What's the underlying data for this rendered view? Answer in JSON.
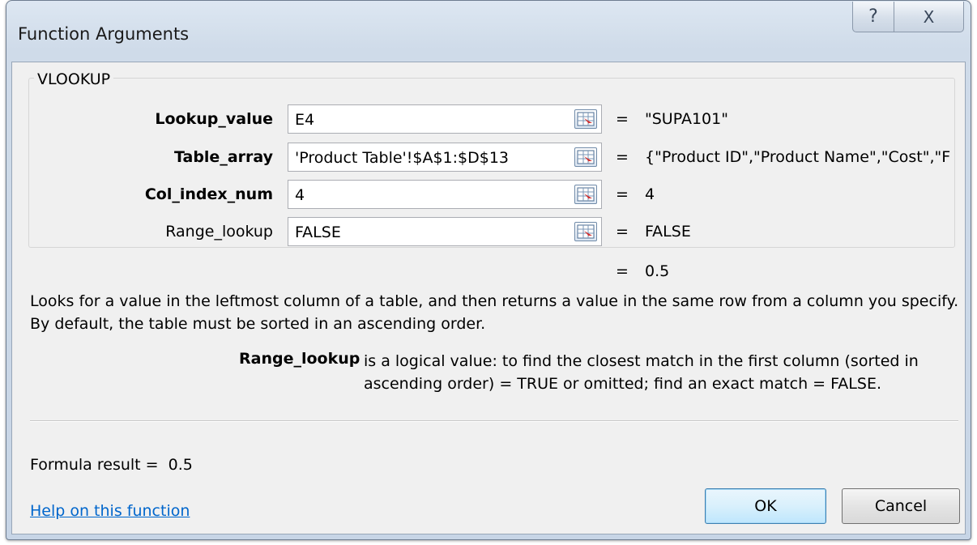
{
  "window": {
    "title": "Function Arguments",
    "help_glyph": "?",
    "close_glyph": "X"
  },
  "function_name": "VLOOKUP",
  "arguments": [
    {
      "label": "Lookup_value",
      "bold": true,
      "value": "E4",
      "evaluated": "\"SUPA101\"",
      "icon": "range-select-icon"
    },
    {
      "label": "Table_array",
      "bold": true,
      "value": "'Product Table'!$A$1:$D$13",
      "evaluated": "{\"Product ID\",\"Product Name\",\"Cost\",\"F",
      "icon": "range-select-icon"
    },
    {
      "label": "Col_index_num",
      "bold": true,
      "value": "4",
      "evaluated": "4",
      "icon": "range-select-icon"
    },
    {
      "label": "Range_lookup",
      "bold": false,
      "value": "FALSE",
      "evaluated": "FALSE",
      "icon": "range-select-icon"
    }
  ],
  "equals_sign": "=",
  "function_result": "0.5",
  "description": "Looks for a value in the leftmost column of a table, and then returns a value in the same row from a column you specify. By default, the table must be sorted in an ascending order.",
  "argument_help": {
    "name": "Range_lookup",
    "text": "is a logical value: to find the closest match in the first column (sorted in ascending order) = TRUE or omitted; find an exact match = FALSE."
  },
  "formula_result": {
    "label": "Formula result =",
    "value": "0.5"
  },
  "help_link": "Help on this function",
  "buttons": {
    "ok": "OK",
    "cancel": "Cancel"
  },
  "colors": {
    "link": "#0066cc",
    "ok_border": "#3c7fb1",
    "dialog_background": "#f0f0f0"
  }
}
